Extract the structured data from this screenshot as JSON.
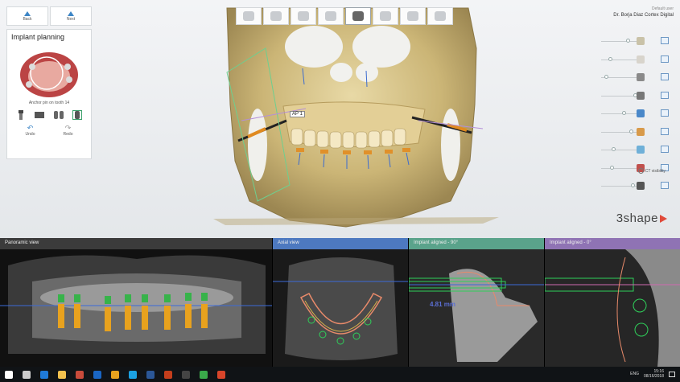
{
  "nav": {
    "back_label": "Back",
    "next_label": "Next"
  },
  "planning": {
    "title": "Implant planning",
    "pin_label": "Anchor pin on tooth 14",
    "undo_label": "Undo",
    "redo_label": "Redo",
    "tools": [
      "implant-tool-icon",
      "abutment-tool-icon",
      "sleeve-tool-icon",
      "guide-tool-icon"
    ]
  },
  "toolbar": {
    "items": [
      "patient-icon",
      "scan-icon",
      "ct-icon",
      "crown-icon",
      "implant-icon",
      "sleeve-icon",
      "guide-icon",
      "export-icon"
    ],
    "active_index": 4
  },
  "user": {
    "status": "Default user",
    "name": "Dr. Borja Diaz  Cortex Digital"
  },
  "layers": [
    {
      "icon": "guide-layer-icon",
      "color": "#c9c2a8",
      "level": 0.7
    },
    {
      "icon": "tissue-layer-icon",
      "color": "#d8d4cc",
      "level": 0.2
    },
    {
      "icon": "sleeve-layer-icon",
      "color": "#8a8a8a",
      "level": 0.1
    },
    {
      "icon": "tooth-layer-icon",
      "color": "#777777",
      "level": 0.9
    },
    {
      "icon": "implant-layer-icon",
      "color": "#4a88c9",
      "level": 0.6
    },
    {
      "icon": "crown-layer-icon",
      "color": "#d89a4a",
      "level": 0.8
    },
    {
      "icon": "nerve-layer-icon",
      "color": "#6fb0d8",
      "level": 0.3
    },
    {
      "icon": "ct-layer-icon",
      "color": "#c0504d",
      "level": 0.25
    },
    {
      "icon": "bone-layer-icon",
      "color": "#555555",
      "level": 0.85
    }
  ],
  "ct_visibility_label": "CT visibility",
  "annotation_label": "AP 1",
  "logo": "3shape",
  "views": [
    {
      "title": "Panoramic view",
      "color": "#3b3b3b"
    },
    {
      "title": "Axial view",
      "color": "#4d79c0"
    },
    {
      "title": "Implant aligned - 90°",
      "color": "#5aa38b"
    },
    {
      "title": "Implant aligned - 0°",
      "color": "#8f73b4"
    }
  ],
  "measurement": "4.81 mm",
  "taskbar": {
    "apps": [
      "start-icon",
      "search-icon",
      "edge-icon",
      "explorer-icon",
      "photos-icon",
      "outlook-icon",
      "chrome-icon",
      "skype-icon",
      "word-icon",
      "powerpoint-icon",
      "implant-studio-icon",
      "camtasia-icon",
      "recorder-icon"
    ],
    "lang": "ENG",
    "time": "15:16",
    "date": "08/16/2018"
  }
}
